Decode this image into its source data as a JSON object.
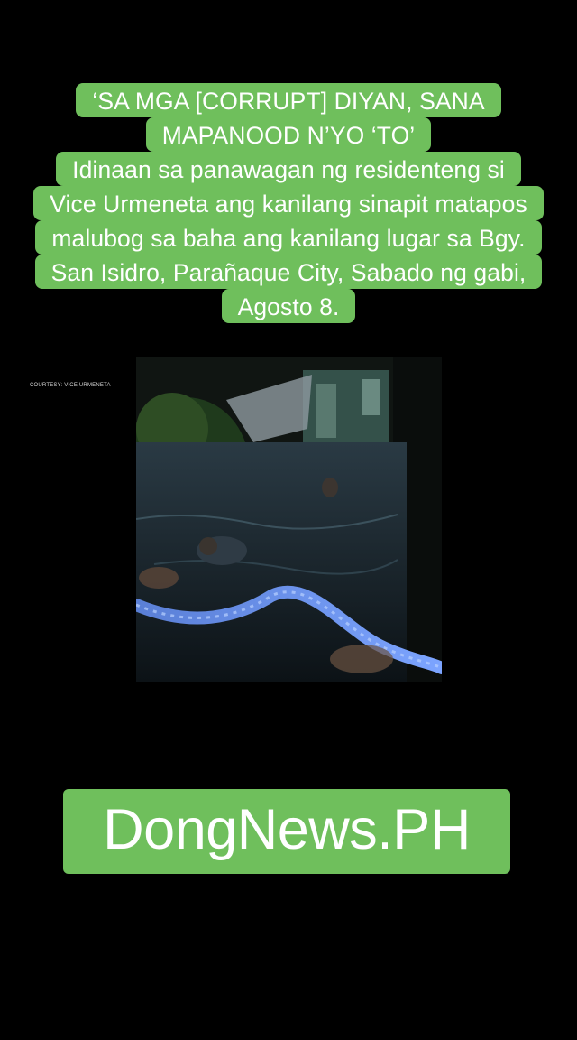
{
  "caption": {
    "lines": [
      "‘SA MGA [CORRUPT] DIYAN, SANA",
      "MAPANOOD N’YO ‘TO’",
      "Idinaan sa panawagan ng residenteng si",
      "Vice Urmeneta ang kanilang sinapit matapos",
      "malubog sa baha ang kanilang lugar sa Bgy.",
      "San Isidro, Parañaque City, Sabado ng gabi,",
      "Agosto 8."
    ]
  },
  "video": {
    "courtesy": "COURTESY: VICE URMENETA"
  },
  "brand": {
    "label": "DongNews.PH"
  },
  "colors": {
    "accent": "#6fbf5c",
    "background": "#000000",
    "text": "#ffffff"
  }
}
